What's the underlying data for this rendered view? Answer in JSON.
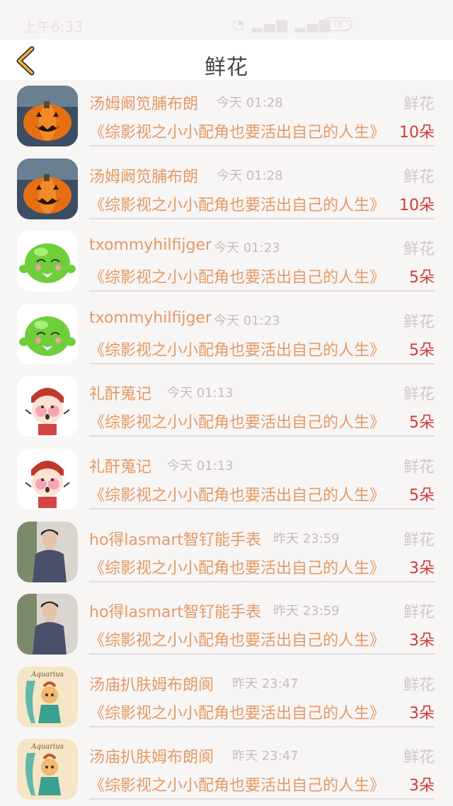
{
  "status_bar": {
    "time": "上午6:33",
    "battery": "76"
  },
  "header": {
    "title": "鲜花"
  },
  "colors": {
    "accent": "#e39a63",
    "count": "#cf3a3a",
    "muted": "#c6bdbd"
  },
  "rows": [
    {
      "avatar": "pumpkin",
      "name": "汤姆阚笕脯布朗",
      "time": "今天 01:28",
      "gift": "鲜花",
      "book": "《综影视之小小配角也要活出自己的人生》",
      "count": "10朵"
    },
    {
      "avatar": "pumpkin",
      "name": "汤姆阚笕脯布朗",
      "time": "今天 01:28",
      "gift": "鲜花",
      "book": "《综影视之小小配角也要活出自己的人生》",
      "count": "10朵"
    },
    {
      "avatar": "green-blob",
      "name": "txommyhilfijger",
      "time": "今天 01:23",
      "gift": "鲜花",
      "book": "《综影视之小小配角也要活出自己的人生》",
      "count": "5朵"
    },
    {
      "avatar": "green-blob",
      "name": "txommyhilfijger",
      "time": "今天 01:23",
      "gift": "鲜花",
      "book": "《综影视之小小配角也要活出自己的人生》",
      "count": "5朵"
    },
    {
      "avatar": "cartoon-face",
      "name": "礼酐蒐记",
      "time": "今天 01:13",
      "gift": "鲜花",
      "book": "《综影视之小小配角也要活出自己的人生》",
      "count": "5朵"
    },
    {
      "avatar": "cartoon-face",
      "name": "礼酐蒐记",
      "time": "今天 01:13",
      "gift": "鲜花",
      "book": "《综影视之小小配角也要活出自己的人生》",
      "count": "5朵"
    },
    {
      "avatar": "person-photo",
      "name": "ho得lasmart智钌能手表",
      "time": "昨天 23:59",
      "gift": "鲜花",
      "book": "《综影视之小小配角也要活出自己的人生》",
      "count": "3朵"
    },
    {
      "avatar": "person-photo",
      "name": "ho得lasmart智钌能手表",
      "time": "昨天 23:59",
      "gift": "鲜花",
      "book": "《综影视之小小配角也要活出自己的人生》",
      "count": "3朵"
    },
    {
      "avatar": "aquarius",
      "name": "汤庙扒肤姆布朗阆",
      "time": "昨天 23:47",
      "gift": "鲜花",
      "book": "《综影视之小小配角也要活出自己的人生》",
      "count": "3朵"
    },
    {
      "avatar": "aquarius",
      "name": "汤庙扒肤姆布朗阆",
      "time": "昨天 23:47",
      "gift": "鲜花",
      "book": "《综影视之小小配角也要活出自己的人生》",
      "count": "3朵"
    }
  ]
}
